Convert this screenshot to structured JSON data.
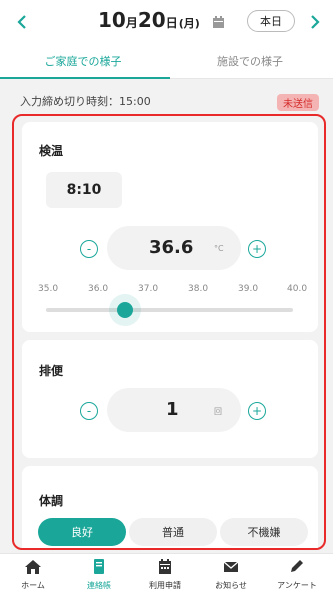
{
  "header": {
    "month_num": "10",
    "month_suffix": "月",
    "day_num": "20",
    "day_suffix": "日",
    "weekday": "(月)",
    "today_label": "本日",
    "prev_icon": "chevron-left-icon",
    "next_icon": "chevron-right-icon"
  },
  "tabs": [
    {
      "label": "ご家庭での様子",
      "active": true
    },
    {
      "label": "施設での様子",
      "active": false
    }
  ],
  "deadline": {
    "text": "入力締め切り時刻：15:00",
    "status_badge": "未送信"
  },
  "temperature": {
    "title": "検温",
    "time": "8:10",
    "value": "36.6",
    "unit": "°C",
    "decrement": "-",
    "increment": "+",
    "scale": [
      "35.0",
      "36.0",
      "37.0",
      "38.0",
      "39.0",
      "40.0"
    ],
    "slider_value": 36.6,
    "slider_min": 35.0,
    "slider_max": 40.0
  },
  "bowel": {
    "title": "排便",
    "value": "1",
    "unit": "回",
    "decrement": "-",
    "increment": "+"
  },
  "condition": {
    "title": "体調",
    "options": [
      {
        "label": "良好",
        "selected": true
      },
      {
        "label": "普通",
        "selected": false
      },
      {
        "label": "不機嫌",
        "selected": false
      }
    ]
  },
  "bottom_nav": [
    {
      "label": "ホーム",
      "icon": "home-icon",
      "active": false
    },
    {
      "label": "連絡帳",
      "icon": "notebook-icon",
      "active": true
    },
    {
      "label": "利用申請",
      "icon": "calendar-icon",
      "active": false
    },
    {
      "label": "お知らせ",
      "icon": "mail-icon",
      "active": false
    },
    {
      "label": "アンケート",
      "icon": "pencil-icon",
      "active": false
    }
  ],
  "colors": {
    "accent": "#1aa79a",
    "alert_border": "#e82a2a",
    "badge_bg": "#f5b4b4",
    "badge_text": "#d42b2b"
  }
}
